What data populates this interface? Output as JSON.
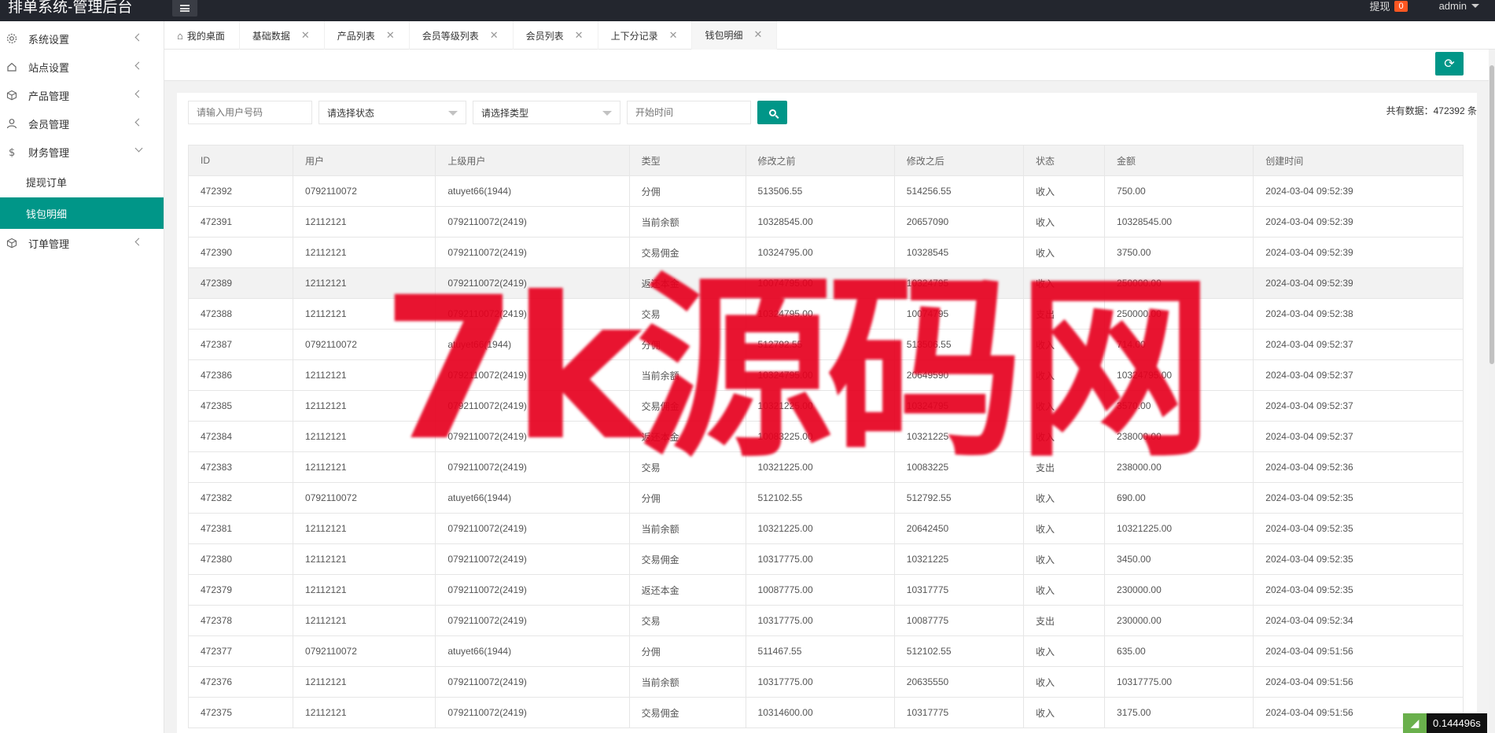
{
  "header": {
    "title": "排单系统-管理后台",
    "withdraw_label": "提现",
    "withdraw_count": "0",
    "user": "admin"
  },
  "sidebar": {
    "items": [
      {
        "label": "系统设置",
        "icon": "gear-icon"
      },
      {
        "label": "站点设置",
        "icon": "house-icon"
      },
      {
        "label": "产品管理",
        "icon": "box-icon"
      },
      {
        "label": "会员管理",
        "icon": "user-icon"
      },
      {
        "label": "财务管理",
        "icon": "dollar-icon"
      },
      {
        "label": "订单管理",
        "icon": "box-icon"
      }
    ],
    "sub_items": [
      {
        "label": "提现订单"
      },
      {
        "label": "钱包明细"
      }
    ]
  },
  "tabs": [
    {
      "label": "我的桌面"
    },
    {
      "label": "基础数据"
    },
    {
      "label": "产品列表"
    },
    {
      "label": "会员等级列表"
    },
    {
      "label": "会员列表"
    },
    {
      "label": "上下分记录"
    },
    {
      "label": "钱包明细"
    }
  ],
  "filters": {
    "user_placeholder": "请输入用户号码",
    "status_select": "请选择状态",
    "type_select": "请选择类型",
    "start_time_placeholder": "开始时间",
    "total_label": "共有数据：472392 条"
  },
  "table": {
    "columns": [
      "ID",
      "用户",
      "上级用户",
      "类型",
      "修改之前",
      "修改之后",
      "状态",
      "金额",
      "创建时间"
    ],
    "rows": [
      [
        "472392",
        "0792110072",
        "atuyet66(1944)",
        "分佣",
        "513506.55",
        "514256.55",
        "收入",
        "750.00",
        "2024-03-04 09:52:39"
      ],
      [
        "472391",
        "12112121",
        "0792110072(2419)",
        "当前余额",
        "10328545.00",
        "20657090",
        "收入",
        "10328545.00",
        "2024-03-04 09:52:39"
      ],
      [
        "472390",
        "12112121",
        "0792110072(2419)",
        "交易佣金",
        "10324795.00",
        "10328545",
        "收入",
        "3750.00",
        "2024-03-04 09:52:39"
      ],
      [
        "472389",
        "12112121",
        "0792110072(2419)",
        "返还本金",
        "10074795.00",
        "10324795",
        "收入",
        "250000.00",
        "2024-03-04 09:52:39"
      ],
      [
        "472388",
        "12112121",
        "0792110072(2419)",
        "交易",
        "10324795.00",
        "10074795",
        "支出",
        "250000.00",
        "2024-03-04 09:52:38"
      ],
      [
        "472387",
        "0792110072",
        "atuyet66(1944)",
        "分佣",
        "512792.55",
        "513506.55",
        "收入",
        "714.00",
        "2024-03-04 09:52:37"
      ],
      [
        "472386",
        "12112121",
        "0792110072(2419)",
        "当前余额",
        "10324795.00",
        "20649590",
        "收入",
        "10324795.00",
        "2024-03-04 09:52:37"
      ],
      [
        "472385",
        "12112121",
        "0792110072(2419)",
        "交易佣金",
        "10321225.00",
        "10324795",
        "收入",
        "3570.00",
        "2024-03-04 09:52:37"
      ],
      [
        "472384",
        "12112121",
        "0792110072(2419)",
        "返还本金",
        "10083225.00",
        "10321225",
        "收入",
        "238000.00",
        "2024-03-04 09:52:37"
      ],
      [
        "472383",
        "12112121",
        "0792110072(2419)",
        "交易",
        "10321225.00",
        "10083225",
        "支出",
        "238000.00",
        "2024-03-04 09:52:36"
      ],
      [
        "472382",
        "0792110072",
        "atuyet66(1944)",
        "分佣",
        "512102.55",
        "512792.55",
        "收入",
        "690.00",
        "2024-03-04 09:52:35"
      ],
      [
        "472381",
        "12112121",
        "0792110072(2419)",
        "当前余额",
        "10321225.00",
        "20642450",
        "收入",
        "10321225.00",
        "2024-03-04 09:52:35"
      ],
      [
        "472380",
        "12112121",
        "0792110072(2419)",
        "交易佣金",
        "10317775.00",
        "10321225",
        "收入",
        "3450.00",
        "2024-03-04 09:52:35"
      ],
      [
        "472379",
        "12112121",
        "0792110072(2419)",
        "返还本金",
        "10087775.00",
        "10317775",
        "收入",
        "230000.00",
        "2024-03-04 09:52:35"
      ],
      [
        "472378",
        "12112121",
        "0792110072(2419)",
        "交易",
        "10317775.00",
        "10087775",
        "支出",
        "230000.00",
        "2024-03-04 09:52:34"
      ],
      [
        "472377",
        "0792110072",
        "atuyet66(1944)",
        "分佣",
        "511467.55",
        "512102.55",
        "收入",
        "635.00",
        "2024-03-04 09:51:56"
      ],
      [
        "472376",
        "12112121",
        "0792110072(2419)",
        "当前余额",
        "10317775.00",
        "20635550",
        "收入",
        "10317775.00",
        "2024-03-04 09:51:56"
      ],
      [
        "472375",
        "12112121",
        "0792110072(2419)",
        "交易佣金",
        "10314600.00",
        "10317775",
        "收入",
        "3175.00",
        "2024-03-04 09:51:56"
      ]
    ]
  },
  "watermark": "7k源码网",
  "timer": "0.144496s",
  "colors": {
    "accent": "#009688",
    "header": "#23262e",
    "badge": "#ff5722",
    "watermark": "#e6001e"
  }
}
